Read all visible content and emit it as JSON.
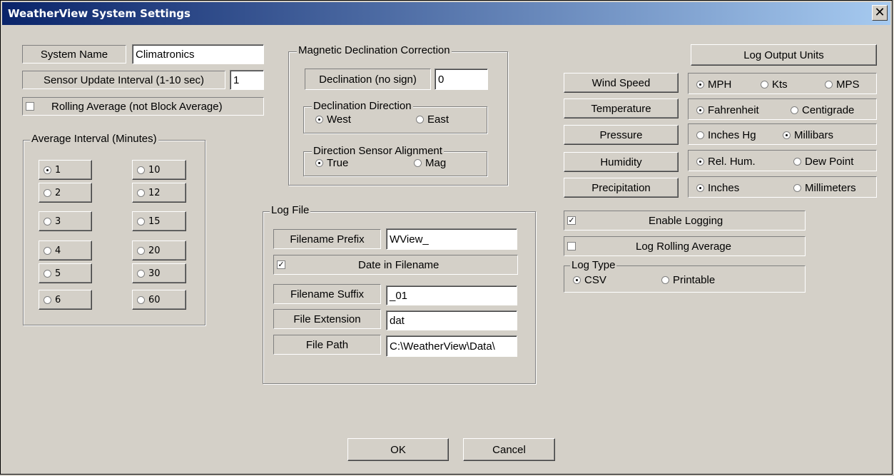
{
  "window": {
    "title": "WeatherView System Settings",
    "close_glyph": "✕"
  },
  "system": {
    "name_label": "System Name",
    "name_value": "Climatronics",
    "interval_label": "Sensor Update Interval (1-10 sec)",
    "interval_value": "1",
    "rolling_label": "Rolling Average (not Block Average)",
    "rolling_checked": false
  },
  "average": {
    "title": "Average Interval (Minutes)",
    "options": [
      "1",
      "10",
      "2",
      "12",
      "3",
      "15",
      "4",
      "20",
      "5",
      "30",
      "6",
      "60"
    ],
    "selected": "1"
  },
  "magnetic": {
    "title": "Magnetic Declination Correction",
    "declination_label": "Declination (no sign)",
    "declination_value": "0",
    "direction_title": "Declination Direction",
    "west": "West",
    "east": "East",
    "alignment_title": "Direction Sensor Alignment",
    "true_label": "True",
    "mag": "Mag"
  },
  "logfile": {
    "title": "Log File",
    "prefix_label": "Filename Prefix",
    "prefix_value": "WView_",
    "date_label": "Date in Filename",
    "suffix_label": "Filename Suffix",
    "suffix_value": "_01",
    "ext_label": "File Extension",
    "ext_value": "dat",
    "path_label": "File Path",
    "path_value": "C:\\WeatherView\\Data\\"
  },
  "units": {
    "header": "Log Output Units",
    "wind": "Wind Speed",
    "mph": "MPH",
    "kts": "Kts",
    "mps": "MPS",
    "temperature": "Temperature",
    "fahrenheit": "Fahrenheit",
    "centigrade": "Centigrade",
    "pressure": "Pressure",
    "inches_hg": "Inches Hg",
    "millibars": "Millibars",
    "humidity": "Humidity",
    "rel_hum": "Rel. Hum.",
    "dew_point": "Dew Point",
    "precipitation": "Precipitation",
    "inches": "Inches",
    "millimeters": "Millimeters"
  },
  "logging": {
    "enable_label": "Enable Logging",
    "rolling_label": "Log Rolling Average",
    "type_title": "Log Type",
    "csv": "CSV",
    "printable": "Printable"
  },
  "buttons": {
    "ok": "OK",
    "cancel": "Cancel"
  }
}
